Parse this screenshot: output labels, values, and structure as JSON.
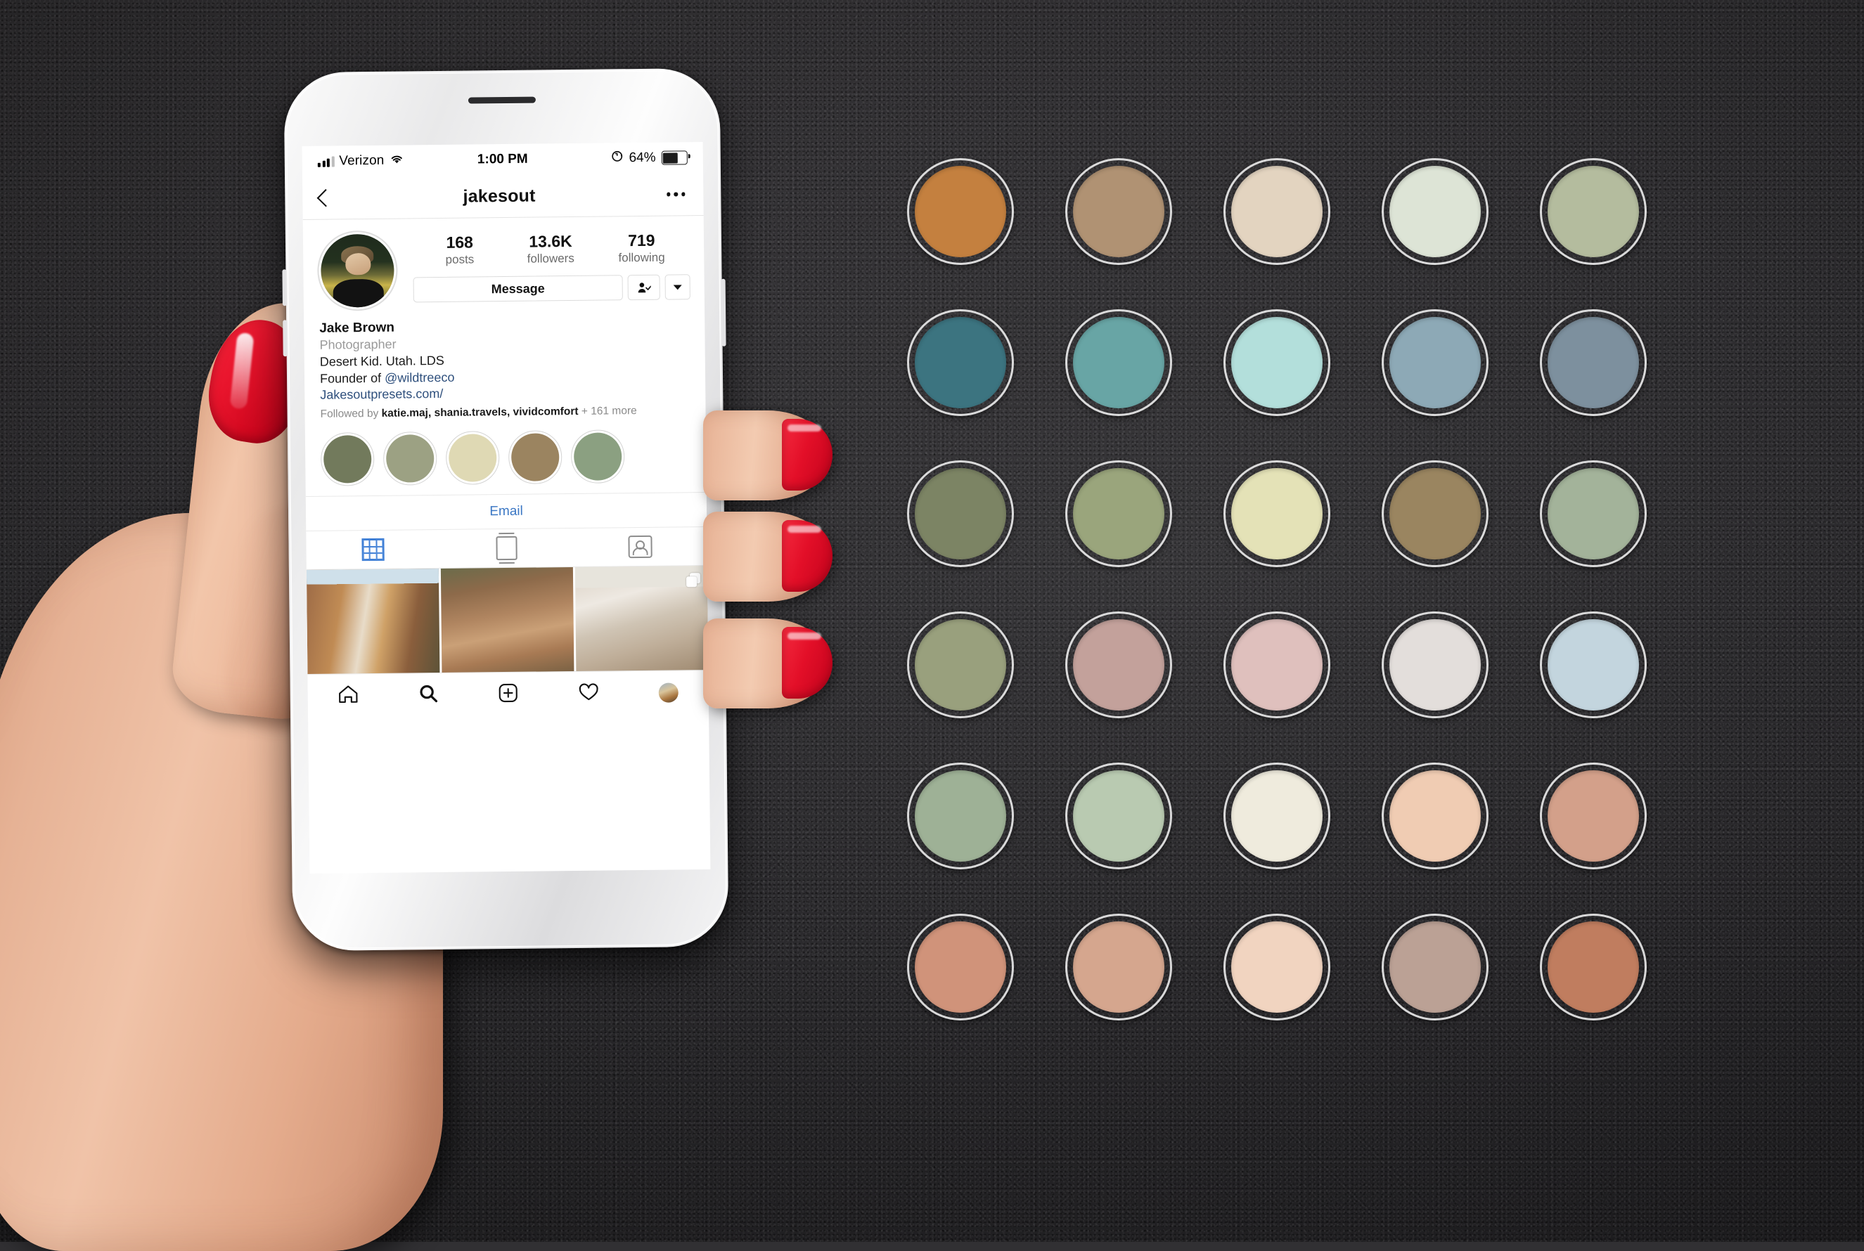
{
  "scene": {
    "background_color": "#313032",
    "description": "hand-held iPhone showing Instagram profile beside a grid of color swatches"
  },
  "hand": {
    "nail_polish_color": "#e3142a",
    "skin_color": "#eebb9e"
  },
  "phone": {
    "body_color": "#f2f2f3",
    "statusbar": {
      "carrier": "Verizon",
      "signal_icon": "cellular-bars-icon",
      "wifi_icon": "wifi-icon",
      "time": "1:00 PM",
      "rotation_lock_icon": "rotation-lock-icon",
      "battery_percent": "64%",
      "battery_level": 64,
      "battery_icon": "battery-icon"
    },
    "navbar": {
      "back_icon": "back-chevron-icon",
      "title": "jakesout",
      "more_icon": "more-options-icon"
    },
    "profile": {
      "avatar_alt": "avatar",
      "stats": [
        {
          "number": "168",
          "label": "posts"
        },
        {
          "number": "13.6K",
          "label": "followers"
        },
        {
          "number": "719",
          "label": "following"
        }
      ],
      "actions": {
        "message_label": "Message",
        "follow_icon": "person-check-icon",
        "dropdown_icon": "chevron-down-icon"
      },
      "bio": {
        "name": "Jake Brown",
        "category": "Photographer",
        "line1": "Desert Kid. Utah. LDS",
        "line2_prefix": "Founder of ",
        "line2_mention": "@wildtreeco",
        "website": "Jakesoutpresets.com/",
        "followed_by_prefix": "Followed by ",
        "followed_by_names": "katie.maj, shania.travels, vividcomfort",
        "followed_by_suffix": " + 161 more"
      },
      "highlights": [
        {
          "color": "#727a5c"
        },
        {
          "color": "#9ca183"
        },
        {
          "color": "#dfd9b4"
        },
        {
          "color": "#9b8460"
        },
        {
          "color": "#8ba081"
        }
      ],
      "email_label": "Email",
      "tabs": [
        {
          "icon": "grid-tab-icon",
          "active": true
        },
        {
          "icon": "reels-tab-icon",
          "active": false
        },
        {
          "icon": "tagged-tab-icon",
          "active": false
        }
      ],
      "posts": [
        {
          "alt": "zion canyon waterfall",
          "multi": false
        },
        {
          "alt": "bighorn sheep on cliff",
          "multi": false
        },
        {
          "alt": "snowy white rock formation",
          "multi": true
        }
      ]
    },
    "tabbar": [
      {
        "icon": "home-icon",
        "label": "Home"
      },
      {
        "icon": "search-icon",
        "label": "Search"
      },
      {
        "icon": "add-post-icon",
        "label": "New Post"
      },
      {
        "icon": "heart-icon",
        "label": "Activity"
      },
      {
        "icon": "profile-avatar-icon",
        "label": "Profile"
      }
    ]
  },
  "swatch_grid": {
    "rows": 6,
    "columns": 5,
    "ring_color": "#ffffff",
    "colors": [
      [
        "#c4803f",
        "#b09273",
        "#e3d4c0",
        "#dde4d6",
        "#b4bc9e"
      ],
      [
        "#3c7480",
        "#68a5a5",
        "#b3dfdb",
        "#8da9b6",
        "#7d909e"
      ],
      [
        "#7c8464",
        "#9aa57c",
        "#e4e2b7",
        "#9a8560",
        "#a3b39a"
      ],
      [
        "#99a07d",
        "#c3a19b",
        "#dfc0bd",
        "#e3dedb",
        "#c3d5de"
      ],
      [
        "#9eb196",
        "#b9cab1",
        "#efebdd",
        "#f0ccb3",
        "#d3a08a"
      ],
      [
        "#d0937a",
        "#d5a68e",
        "#f1d4c0",
        "#bba195",
        "#c07d5f"
      ]
    ]
  }
}
